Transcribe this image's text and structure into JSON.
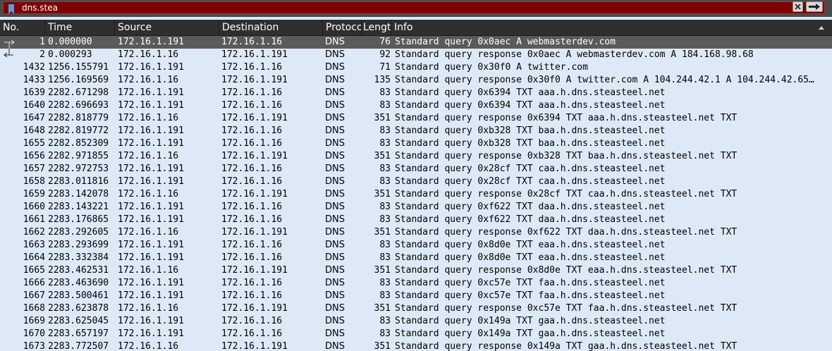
{
  "filter": {
    "value": "dns.stea",
    "bookmark_icon": "bookmark-icon",
    "clear_icon": "clear-x-icon",
    "apply_icon": "arrow-right-icon",
    "background_color": "#7e0000"
  },
  "columns": {
    "no": "No.",
    "time": "Time",
    "source": "Source",
    "destination": "Destination",
    "protocol": "Protoco",
    "length": "Lengtl",
    "info": "Info",
    "sort_icon": "sort-ascending-icon"
  },
  "colors": {
    "row_background": "#dde9f6",
    "selected_background": "#5a5a5a",
    "header_background": "#2f2f2f"
  },
  "packets": [
    {
      "no": "1",
      "time": "0.000000",
      "source": "172.16.1.191",
      "destination": "172.16.1.16",
      "protocol": "DNS",
      "length": "76",
      "info": "Standard query 0x0aec A webmasterdev.com",
      "selected": true,
      "relation": "request"
    },
    {
      "no": "2",
      "time": "0.000293",
      "source": "172.16.1.16",
      "destination": "172.16.1.191",
      "protocol": "DNS",
      "length": "92",
      "info": "Standard query response 0x0aec A webmasterdev.com A 184.168.98.68",
      "selected": false,
      "relation": "response"
    },
    {
      "no": "1432",
      "time": "1256.155791",
      "source": "172.16.1.191",
      "destination": "172.16.1.16",
      "protocol": "DNS",
      "length": "71",
      "info": "Standard query 0x30f0 A twitter.com",
      "selected": false
    },
    {
      "no": "1433",
      "time": "1256.169569",
      "source": "172.16.1.16",
      "destination": "172.16.1.191",
      "protocol": "DNS",
      "length": "135",
      "info": "Standard query response 0x30f0 A twitter.com A 104.244.42.1 A 104.244.42.65…",
      "selected": false
    },
    {
      "no": "1639",
      "time": "2282.671298",
      "source": "172.16.1.191",
      "destination": "172.16.1.16",
      "protocol": "DNS",
      "length": "83",
      "info": "Standard query 0x6394 TXT aaa.h.dns.steasteel.net",
      "selected": false
    },
    {
      "no": "1640",
      "time": "2282.696693",
      "source": "172.16.1.191",
      "destination": "172.16.1.16",
      "protocol": "DNS",
      "length": "83",
      "info": "Standard query 0x6394 TXT aaa.h.dns.steasteel.net",
      "selected": false
    },
    {
      "no": "1647",
      "time": "2282.818779",
      "source": "172.16.1.16",
      "destination": "172.16.1.191",
      "protocol": "DNS",
      "length": "351",
      "info": "Standard query response 0x6394 TXT aaa.h.dns.steasteel.net TXT",
      "selected": false
    },
    {
      "no": "1648",
      "time": "2282.819772",
      "source": "172.16.1.191",
      "destination": "172.16.1.16",
      "protocol": "DNS",
      "length": "83",
      "info": "Standard query 0xb328 TXT baa.h.dns.steasteel.net",
      "selected": false
    },
    {
      "no": "1655",
      "time": "2282.852309",
      "source": "172.16.1.191",
      "destination": "172.16.1.16",
      "protocol": "DNS",
      "length": "83",
      "info": "Standard query 0xb328 TXT baa.h.dns.steasteel.net",
      "selected": false
    },
    {
      "no": "1656",
      "time": "2282.971855",
      "source": "172.16.1.16",
      "destination": "172.16.1.191",
      "protocol": "DNS",
      "length": "351",
      "info": "Standard query response 0xb328 TXT baa.h.dns.steasteel.net TXT",
      "selected": false
    },
    {
      "no": "1657",
      "time": "2282.972753",
      "source": "172.16.1.191",
      "destination": "172.16.1.16",
      "protocol": "DNS",
      "length": "83",
      "info": "Standard query 0x28cf TXT caa.h.dns.steasteel.net",
      "selected": false
    },
    {
      "no": "1658",
      "time": "2283.011816",
      "source": "172.16.1.191",
      "destination": "172.16.1.16",
      "protocol": "DNS",
      "length": "83",
      "info": "Standard query 0x28cf TXT caa.h.dns.steasteel.net",
      "selected": false
    },
    {
      "no": "1659",
      "time": "2283.142078",
      "source": "172.16.1.16",
      "destination": "172.16.1.191",
      "protocol": "DNS",
      "length": "351",
      "info": "Standard query response 0x28cf TXT caa.h.dns.steasteel.net TXT",
      "selected": false
    },
    {
      "no": "1660",
      "time": "2283.143221",
      "source": "172.16.1.191",
      "destination": "172.16.1.16",
      "protocol": "DNS",
      "length": "83",
      "info": "Standard query 0xf622 TXT daa.h.dns.steasteel.net",
      "selected": false
    },
    {
      "no": "1661",
      "time": "2283.176865",
      "source": "172.16.1.191",
      "destination": "172.16.1.16",
      "protocol": "DNS",
      "length": "83",
      "info": "Standard query 0xf622 TXT daa.h.dns.steasteel.net",
      "selected": false
    },
    {
      "no": "1662",
      "time": "2283.292605",
      "source": "172.16.1.16",
      "destination": "172.16.1.191",
      "protocol": "DNS",
      "length": "351",
      "info": "Standard query response 0xf622 TXT daa.h.dns.steasteel.net TXT",
      "selected": false
    },
    {
      "no": "1663",
      "time": "2283.293699",
      "source": "172.16.1.191",
      "destination": "172.16.1.16",
      "protocol": "DNS",
      "length": "83",
      "info": "Standard query 0x8d0e TXT eaa.h.dns.steasteel.net",
      "selected": false
    },
    {
      "no": "1664",
      "time": "2283.332384",
      "source": "172.16.1.191",
      "destination": "172.16.1.16",
      "protocol": "DNS",
      "length": "83",
      "info": "Standard query 0x8d0e TXT eaa.h.dns.steasteel.net",
      "selected": false
    },
    {
      "no": "1665",
      "time": "2283.462531",
      "source": "172.16.1.16",
      "destination": "172.16.1.191",
      "protocol": "DNS",
      "length": "351",
      "info": "Standard query response 0x8d0e TXT eaa.h.dns.steasteel.net TXT",
      "selected": false
    },
    {
      "no": "1666",
      "time": "2283.463690",
      "source": "172.16.1.191",
      "destination": "172.16.1.16",
      "protocol": "DNS",
      "length": "83",
      "info": "Standard query 0xc57e TXT faa.h.dns.steasteel.net",
      "selected": false
    },
    {
      "no": "1667",
      "time": "2283.500461",
      "source": "172.16.1.191",
      "destination": "172.16.1.16",
      "protocol": "DNS",
      "length": "83",
      "info": "Standard query 0xc57e TXT faa.h.dns.steasteel.net",
      "selected": false
    },
    {
      "no": "1668",
      "time": "2283.623878",
      "source": "172.16.1.16",
      "destination": "172.16.1.191",
      "protocol": "DNS",
      "length": "351",
      "info": "Standard query response 0xc57e TXT faa.h.dns.steasteel.net TXT",
      "selected": false
    },
    {
      "no": "1669",
      "time": "2283.625045",
      "source": "172.16.1.191",
      "destination": "172.16.1.16",
      "protocol": "DNS",
      "length": "83",
      "info": "Standard query 0x149a TXT gaa.h.dns.steasteel.net",
      "selected": false
    },
    {
      "no": "1670",
      "time": "2283.657197",
      "source": "172.16.1.191",
      "destination": "172.16.1.16",
      "protocol": "DNS",
      "length": "83",
      "info": "Standard query 0x149a TXT gaa.h.dns.steasteel.net",
      "selected": false
    },
    {
      "no": "1673",
      "time": "2283.772507",
      "source": "172.16.1.16",
      "destination": "172.16.1.191",
      "protocol": "DNS",
      "length": "351",
      "info": "Standard query response 0x149a TXT gaa.h.dns.steasteel.net TXT",
      "selected": false
    }
  ]
}
